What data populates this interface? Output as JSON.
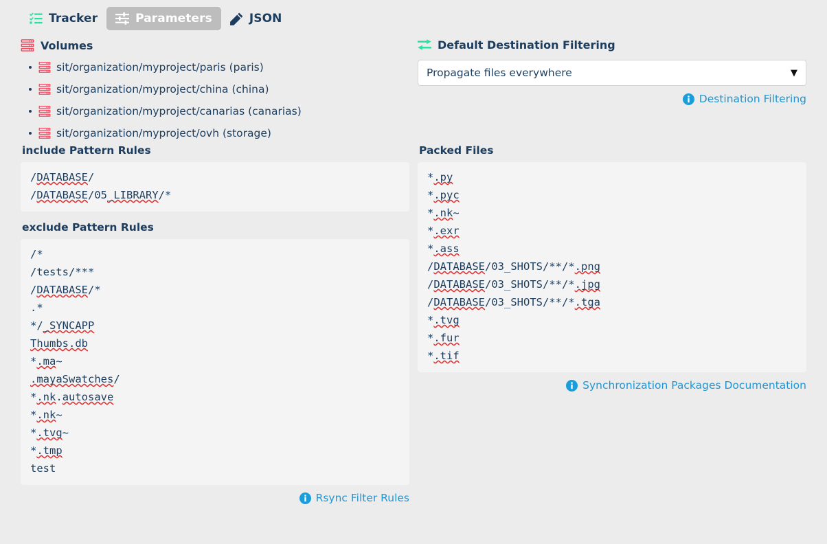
{
  "tabs": [
    {
      "label": "Tracker",
      "icon": "tasks-icon",
      "active": false
    },
    {
      "label": "Parameters",
      "icon": "sliders-icon",
      "active": true
    },
    {
      "label": "JSON",
      "icon": "pencil-icon",
      "active": false
    }
  ],
  "volumes": {
    "heading": "Volumes",
    "icon": "server-icon",
    "items": [
      {
        "label": "sit/organization/myproject/paris (paris)",
        "icon": "server-icon"
      },
      {
        "label": "sit/organization/myproject/china (china)",
        "icon": "server-icon"
      },
      {
        "label": "sit/organization/myproject/canarias (canarias)",
        "icon": "server-icon"
      },
      {
        "label": "sit/organization/myproject/ovh (storage)",
        "icon": "server-icon"
      }
    ]
  },
  "destination_filtering": {
    "heading": "Default Destination Filtering",
    "icon": "exchange-icon",
    "select_value": "Propagate files everywhere",
    "caret": "▼",
    "link_label": "Destination Filtering",
    "link_icon": "info-icon"
  },
  "include_rules": {
    "heading": "include Pattern Rules",
    "lines": [
      "/DATABASE/",
      "/DATABASE/05_LIBRARY/*"
    ]
  },
  "exclude_rules": {
    "heading": "exclude Pattern Rules",
    "lines": [
      "/*",
      "/tests/***",
      "/DATABASE/*",
      ".*",
      "*/_SYNCAPP",
      "Thumbs.db",
      "*.ma~",
      ".mayaSwatches/",
      "*.nk.autosave",
      "*.nk~",
      "*.tvg~",
      "*.tmp",
      "test"
    ],
    "link_label": "Rsync Filter Rules",
    "link_icon": "info-icon"
  },
  "packed_files": {
    "heading": "Packed Files",
    "lines": [
      "*.py",
      "*.pyc",
      "*.nk~",
      "*.exr",
      "*.ass",
      "/DATABASE/03_SHOTS/**/*.png",
      "/DATABASE/03_SHOTS/**/*.jpg",
      "/DATABASE/03_SHOTS/**/*.tga",
      "*.tvg",
      "*.fur",
      "*.tif"
    ],
    "link_label": "Synchronization Packages Documentation",
    "link_icon": "info-icon"
  },
  "colors": {
    "page_bg": "#ececec",
    "panel_bg": "#f4f4f4",
    "text": "#1c3d5e",
    "accent_link": "#2196d3",
    "accent_green": "#2be0a0",
    "accent_red": "#f4455c",
    "active_tab_bg": "#bdbdbd",
    "spell_underline": "#e03030"
  }
}
